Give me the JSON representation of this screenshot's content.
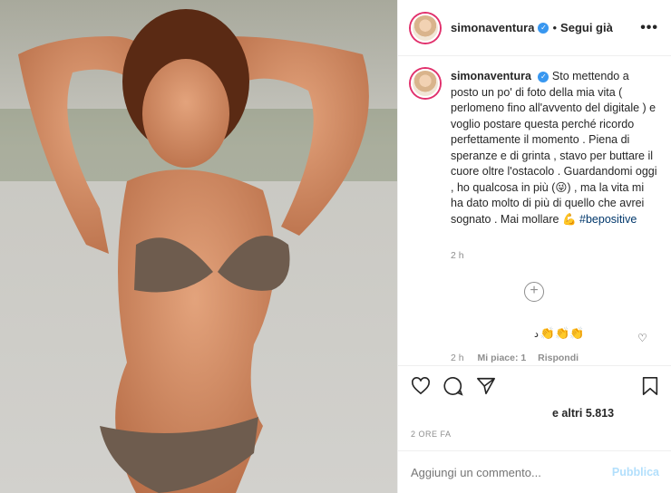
{
  "header": {
    "username": "simonaventura",
    "separator": "•",
    "follow_label": "Segui già",
    "more_label": "•••"
  },
  "caption": {
    "username": "simonaventura",
    "text": "Sto mettendo a posto un po' di foto della mia vita ( perlomeno fino all'avvento del digitale ) e voglio postare questa perché ricordo perfettamente il momento . Piena di speranze e di grinta , stavo per buttare il cuore oltre l'ostacolo . Guardandomi oggi , ho qualcosa in più (😜) , ma la vita mi ha dato molto di più di quello che avrei sognato . Mai mollare 💪",
    "hashtag": "#bepositive",
    "time": "2 h"
  },
  "comment": {
    "text": "👏👏👏",
    "prefix": "د",
    "time": "2 h",
    "likes": "Mi piace: 1",
    "reply": "Rispondi"
  },
  "actions": {
    "like_icon": "heart-icon",
    "comment_icon": "comment-icon",
    "share_icon": "share-icon",
    "save_icon": "bookmark-icon"
  },
  "likes_text": "e altri 5.813",
  "date_text": "2 ORE FA",
  "add_comment": {
    "placeholder": "Aggiungi un commento...",
    "publish_label": "Pubblica"
  },
  "colors": {
    "accent": "#3897f0",
    "publish_disabled": "#b2dffc",
    "story_ring": "#e1306c"
  }
}
